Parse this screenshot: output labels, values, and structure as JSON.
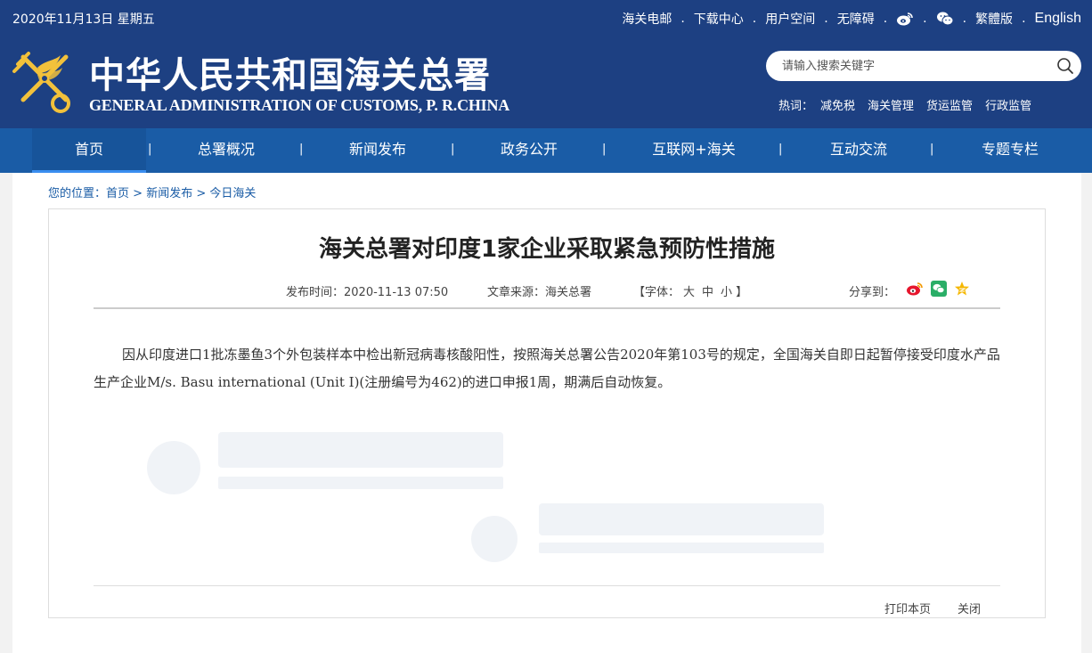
{
  "header": {
    "date": "2020年11月13日 星期五",
    "top_links": [
      "海关电邮",
      "下载中心",
      "用户空间",
      "无障碍"
    ],
    "social_icons": [
      "weibo-icon",
      "wechat-icon"
    ],
    "lang_traditional": "繁體版",
    "lang_english": "English",
    "logo_cn": "中华人民共和国海关总署",
    "logo_en": "GENERAL ADMINISTRATION OF CUSTOMS, P. R.CHINA",
    "search_placeholder": "请输入搜索关键字",
    "hot_label": "热词：",
    "hot_words": [
      "减免税",
      "海关管理",
      "货运监管",
      "行政监管"
    ]
  },
  "nav": {
    "items": [
      "首页",
      "总署概况",
      "新闻发布",
      "政务公开",
      "互联网+海关",
      "互动交流",
      "专题专栏"
    ],
    "active": "首页"
  },
  "breadcrumb": {
    "prefix": "您的位置：",
    "items": [
      "首页",
      "新闻发布",
      "今日海关"
    ],
    "separator": " > "
  },
  "article": {
    "title": "海关总署对印度1家企业采取紧急预防性措施",
    "publish_label": "发布时间：",
    "publish_time": "2020-11-13 07:50",
    "source_label": "文章来源：",
    "source": "海关总署",
    "font_label": "【字体：",
    "font_sizes": [
      "大",
      "中",
      "小"
    ],
    "font_close": "】",
    "share_label": "分享到：",
    "share_icons": [
      "weibo-share-icon",
      "wechat-share-icon",
      "qzone-share-icon"
    ],
    "body": "因从印度进口1批冻墨鱼3个外包装样本中检出新冠病毒核酸阳性，按照海关总署公告2020年第103号的规定，全国海关自即日起暂停接受印度水产品生产企业M/s. Basu international (Unit I)(注册编号为462)的进口申报1周，期满后自动恢复。",
    "print_label": "打印本页",
    "close_label": "关闭"
  },
  "colors": {
    "header_bg": "#1d4082",
    "nav_bg": "#1a5ca6",
    "link": "#1a5ca6"
  }
}
